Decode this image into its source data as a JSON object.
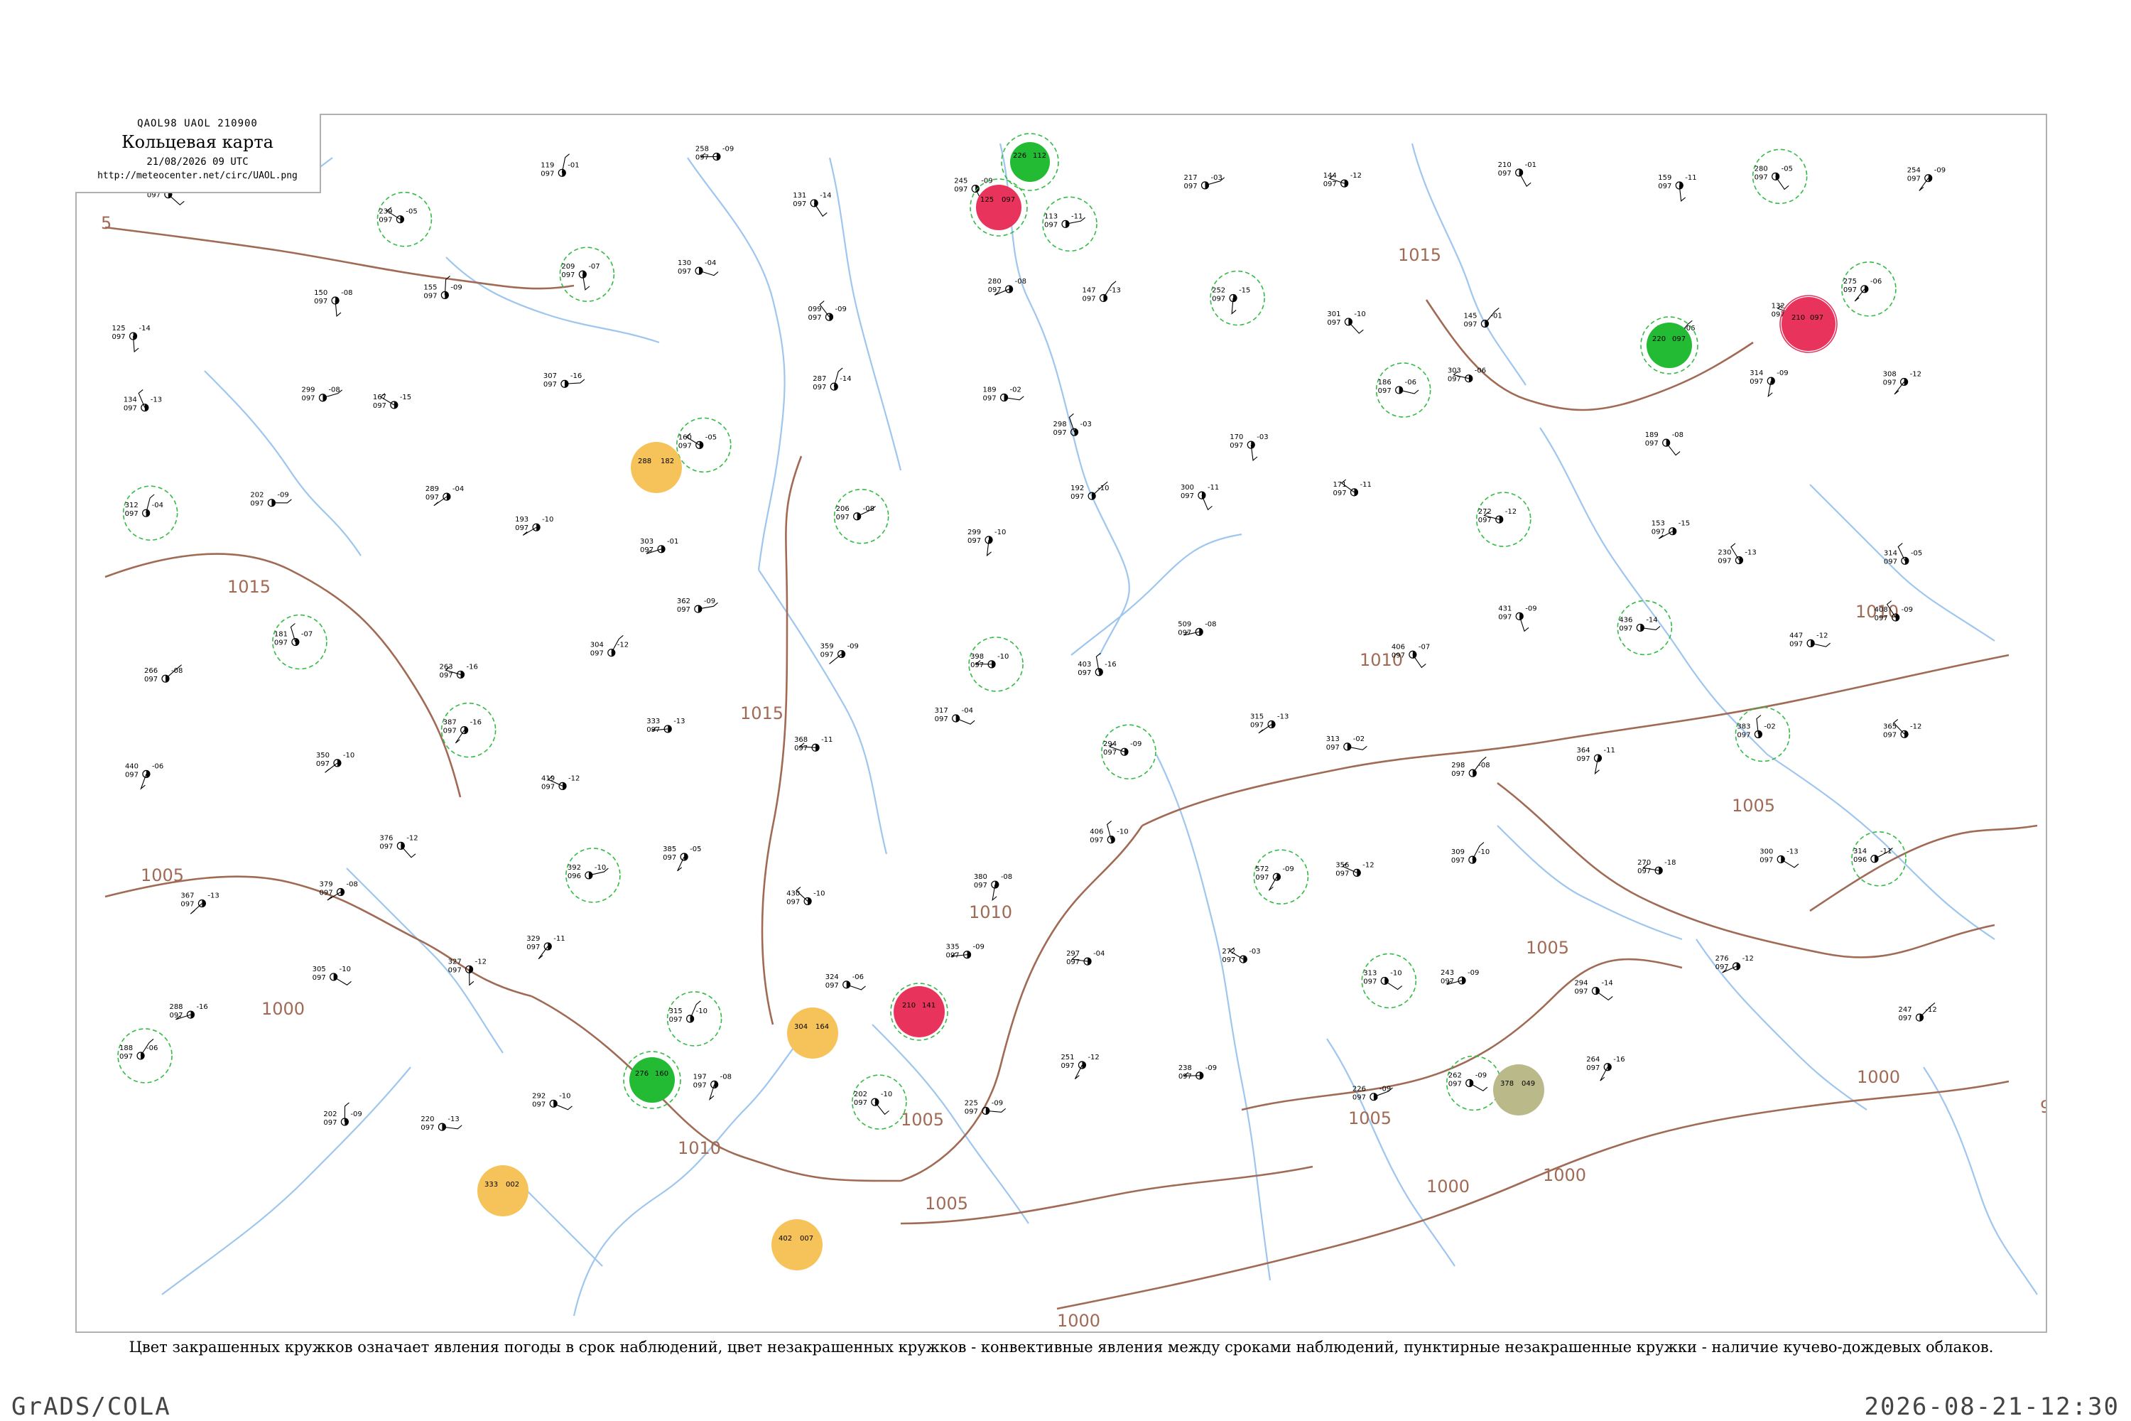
{
  "header": {
    "code_line": "QAOL98  UAOL  210900",
    "title": "Кольцевая карта",
    "date_line": "21/08/2026 09 UTC",
    "url": "http://meteocenter.net/circ/UAOL.png"
  },
  "caption": "Цвет закрашенных кружков означает явления погоды в срок наблюдений, цвет незакрашенных кружков - конвективные явления между сроками наблюдений, пунктирные незакрашенные кружки - наличие кучево-дождевых облаков.",
  "footer": {
    "left": "GrADS/COLA",
    "right": "2026-08-21-12:30"
  },
  "colors": {
    "isobar": "#a06a55",
    "river": "#9ec6ee",
    "phenomenon_red": "#e8345c",
    "phenomenon_green": "#22bb33",
    "phenomenon_orange": "#f6c35a",
    "phenomenon_olive": "#b9b98a",
    "cb_dashed": "#33bb44"
  },
  "isobars": [
    {
      "label": "5"
    },
    {
      "label": "1015"
    },
    {
      "label": "1015"
    },
    {
      "label": "1015"
    },
    {
      "label": "1010"
    },
    {
      "label": "1010"
    },
    {
      "label": "1010"
    },
    {
      "label": "1010"
    },
    {
      "label": "1005"
    },
    {
      "label": "1005"
    },
    {
      "label": "1005"
    },
    {
      "label": "1005"
    },
    {
      "label": "1000"
    },
    {
      "label": "1000"
    },
    {
      "label": "1000"
    },
    {
      "label": "1005"
    },
    {
      "label": "1005"
    },
    {
      "label": "1000"
    },
    {
      "label": "1000"
    },
    {
      "label": "9"
    }
  ],
  "highlighted_stations": [
    {
      "id": "hl-1",
      "type": "red",
      "values": [
        "125",
        "097"
      ]
    },
    {
      "id": "hl-2",
      "type": "green",
      "values": [
        "226",
        "112"
      ]
    },
    {
      "id": "hl-3",
      "type": "red",
      "values": [
        "210",
        "097"
      ]
    },
    {
      "id": "hl-4",
      "type": "green",
      "values": [
        "220",
        "097"
      ]
    },
    {
      "id": "hl-5",
      "type": "orange",
      "values": [
        "288",
        "182"
      ]
    },
    {
      "id": "hl-6",
      "type": "red",
      "values": [
        "210",
        "141"
      ]
    },
    {
      "id": "hl-7",
      "type": "green",
      "values": [
        "276",
        "160"
      ]
    },
    {
      "id": "hl-8",
      "type": "orange",
      "values": [
        "304",
        "164"
      ]
    },
    {
      "id": "hl-9",
      "type": "orange",
      "values": [
        "333",
        "002"
      ]
    },
    {
      "id": "hl-10",
      "type": "orange",
      "values": [
        "402",
        "007"
      ]
    },
    {
      "id": "hl-11",
      "type": "olive",
      "values": [
        "378",
        "049"
      ]
    }
  ],
  "stations": [
    {
      "t": "271",
      "p": "097",
      "d": "-09"
    },
    {
      "t": "134",
      "p": "097",
      "d": "-07"
    },
    {
      "t": "239",
      "p": "097",
      "d": "-05"
    },
    {
      "t": "119",
      "p": "097",
      "d": "-01"
    },
    {
      "t": "258",
      "p": "097",
      "d": "-09"
    },
    {
      "t": "131",
      "p": "097",
      "d": "-14"
    },
    {
      "t": "245",
      "p": "097",
      "d": "-09"
    },
    {
      "t": "113",
      "p": "097",
      "d": "-11"
    },
    {
      "t": "217",
      "p": "097",
      "d": "-03"
    },
    {
      "t": "144",
      "p": "097",
      "d": "-12"
    },
    {
      "t": "210",
      "p": "097",
      "d": "-01"
    },
    {
      "t": "159",
      "p": "097",
      "d": "-11"
    },
    {
      "t": "280",
      "p": "097",
      "d": "-05"
    },
    {
      "t": "254",
      "p": "097",
      "d": "-09"
    },
    {
      "t": "125",
      "p": "097",
      "d": "-14"
    },
    {
      "t": "150",
      "p": "097",
      "d": "-08"
    },
    {
      "t": "155",
      "p": "097",
      "d": "-09"
    },
    {
      "t": "209",
      "p": "097",
      "d": "-07"
    },
    {
      "t": "130",
      "p": "097",
      "d": "-04"
    },
    {
      "t": "099",
      "p": "097",
      "d": "-09"
    },
    {
      "t": "280",
      "p": "097",
      "d": "-08"
    },
    {
      "t": "147",
      "p": "097",
      "d": "-13"
    },
    {
      "t": "252",
      "p": "097",
      "d": "-15"
    },
    {
      "t": "301",
      "p": "097",
      "d": "-10"
    },
    {
      "t": "145",
      "p": "097",
      "d": "-01"
    },
    {
      "t": "278",
      "p": "097",
      "d": "-06"
    },
    {
      "t": "132",
      "p": "097",
      "d": "-13"
    },
    {
      "t": "275",
      "p": "097",
      "d": "-06"
    },
    {
      "t": "134",
      "p": "097",
      "d": "-13"
    },
    {
      "t": "299",
      "p": "097",
      "d": "-08"
    },
    {
      "t": "167",
      "p": "097",
      "d": "-15"
    },
    {
      "t": "307",
      "p": "097",
      "d": "-16"
    },
    {
      "t": "160",
      "p": "097",
      "d": "-05"
    },
    {
      "t": "287",
      "p": "097",
      "d": "-14"
    },
    {
      "t": "189",
      "p": "097",
      "d": "-02"
    },
    {
      "t": "298",
      "p": "097",
      "d": "-03"
    },
    {
      "t": "170",
      "p": "097",
      "d": "-03"
    },
    {
      "t": "186",
      "p": "097",
      "d": "-06"
    },
    {
      "t": "303",
      "p": "097",
      "d": "-06"
    },
    {
      "t": "189",
      "p": "097",
      "d": "-08"
    },
    {
      "t": "314",
      "p": "097",
      "d": "-09"
    },
    {
      "t": "308",
      "p": "097",
      "d": "-12"
    },
    {
      "t": "312",
      "p": "097",
      "d": "-04"
    },
    {
      "t": "202",
      "p": "097",
      "d": "-09"
    },
    {
      "t": "289",
      "p": "097",
      "d": "-04"
    },
    {
      "t": "193",
      "p": "097",
      "d": "-10"
    },
    {
      "t": "303",
      "p": "097",
      "d": "-01"
    },
    {
      "t": "206",
      "p": "097",
      "d": "-08"
    },
    {
      "t": "299",
      "p": "097",
      "d": "-10"
    },
    {
      "t": "192",
      "p": "097",
      "d": "-10"
    },
    {
      "t": "300",
      "p": "097",
      "d": "-11"
    },
    {
      "t": "171",
      "p": "097",
      "d": "-11"
    },
    {
      "t": "272",
      "p": "097",
      "d": "-12"
    },
    {
      "t": "153",
      "p": "097",
      "d": "-15"
    },
    {
      "t": "230",
      "p": "097",
      "d": "-13"
    },
    {
      "t": "314",
      "p": "097",
      "d": "-05"
    },
    {
      "t": "266",
      "p": "097",
      "d": "-08"
    },
    {
      "t": "181",
      "p": "097",
      "d": "-07"
    },
    {
      "t": "263",
      "p": "097",
      "d": "-16"
    },
    {
      "t": "304",
      "p": "097",
      "d": "-12"
    },
    {
      "t": "362",
      "p": "097",
      "d": "-09"
    },
    {
      "t": "359",
      "p": "097",
      "d": "-09"
    },
    {
      "t": "398",
      "p": "097",
      "d": "-10"
    },
    {
      "t": "403",
      "p": "097",
      "d": "-16"
    },
    {
      "t": "509",
      "p": "097",
      "d": "-08"
    },
    {
      "t": "406",
      "p": "097",
      "d": "-07"
    },
    {
      "t": "431",
      "p": "097",
      "d": "-09"
    },
    {
      "t": "436",
      "p": "097",
      "d": "-14"
    },
    {
      "t": "447",
      "p": "097",
      "d": "-12"
    },
    {
      "t": "408",
      "p": "097",
      "d": "-09"
    },
    {
      "t": "440",
      "p": "097",
      "d": "-06"
    },
    {
      "t": "350",
      "p": "097",
      "d": "-10"
    },
    {
      "t": "387",
      "p": "097",
      "d": "-16"
    },
    {
      "t": "419",
      "p": "097",
      "d": "-12"
    },
    {
      "t": "333",
      "p": "097",
      "d": "-13"
    },
    {
      "t": "368",
      "p": "097",
      "d": "-11"
    },
    {
      "t": "317",
      "p": "097",
      "d": "-04"
    },
    {
      "t": "294",
      "p": "097",
      "d": "-09"
    },
    {
      "t": "315",
      "p": "097",
      "d": "-13"
    },
    {
      "t": "313",
      "p": "097",
      "d": "-02"
    },
    {
      "t": "298",
      "p": "097",
      "d": "-08"
    },
    {
      "t": "364",
      "p": "097",
      "d": "-11"
    },
    {
      "t": "383",
      "p": "097",
      "d": "-02"
    },
    {
      "t": "365",
      "p": "097",
      "d": "-12"
    },
    {
      "t": "367",
      "p": "097",
      "d": "-13"
    },
    {
      "t": "379",
      "p": "097",
      "d": "-08"
    },
    {
      "t": "376",
      "p": "097",
      "d": "-12"
    },
    {
      "t": "392",
      "p": "096",
      "d": "-10"
    },
    {
      "t": "385",
      "p": "097",
      "d": "-05"
    },
    {
      "t": "430",
      "p": "097",
      "d": "-10"
    },
    {
      "t": "380",
      "p": "097",
      "d": "-08"
    },
    {
      "t": "406",
      "p": "097",
      "d": "-10"
    },
    {
      "t": "572",
      "p": "097",
      "d": "-09"
    },
    {
      "t": "356",
      "p": "097",
      "d": "-12"
    },
    {
      "t": "309",
      "p": "097",
      "d": "-10"
    },
    {
      "t": "270",
      "p": "097",
      "d": "-18"
    },
    {
      "t": "300",
      "p": "097",
      "d": "-13"
    },
    {
      "t": "314",
      "p": "096",
      "d": "-11"
    },
    {
      "t": "288",
      "p": "097",
      "d": "-16"
    },
    {
      "t": "305",
      "p": "097",
      "d": "-10"
    },
    {
      "t": "327",
      "p": "097",
      "d": "-12"
    },
    {
      "t": "329",
      "p": "097",
      "d": "-11"
    },
    {
      "t": "315",
      "p": "097",
      "d": "-10"
    },
    {
      "t": "324",
      "p": "097",
      "d": "-06"
    },
    {
      "t": "335",
      "p": "097",
      "d": "-09"
    },
    {
      "t": "297",
      "p": "097",
      "d": "-04"
    },
    {
      "t": "272",
      "p": "097",
      "d": "-03"
    },
    {
      "t": "313",
      "p": "097",
      "d": "-10"
    },
    {
      "t": "243",
      "p": "097",
      "d": "-09"
    },
    {
      "t": "294",
      "p": "097",
      "d": "-14"
    },
    {
      "t": "276",
      "p": "097",
      "d": "-12"
    },
    {
      "t": "247",
      "p": "097",
      "d": "-12"
    },
    {
      "t": "188",
      "p": "097",
      "d": "-06"
    },
    {
      "t": "202",
      "p": "097",
      "d": "-09"
    },
    {
      "t": "220",
      "p": "097",
      "d": "-13"
    },
    {
      "t": "292",
      "p": "097",
      "d": "-10"
    },
    {
      "t": "197",
      "p": "097",
      "d": "-08"
    },
    {
      "t": "202",
      "p": "097",
      "d": "-10"
    },
    {
      "t": "225",
      "p": "097",
      "d": "-09"
    },
    {
      "t": "251",
      "p": "097",
      "d": "-12"
    },
    {
      "t": "238",
      "p": "097",
      "d": "-09"
    },
    {
      "t": "226",
      "p": "097",
      "d": "-09"
    },
    {
      "t": "262",
      "p": "097",
      "d": "-09"
    },
    {
      "t": "264",
      "p": "097",
      "d": "-16"
    }
  ]
}
